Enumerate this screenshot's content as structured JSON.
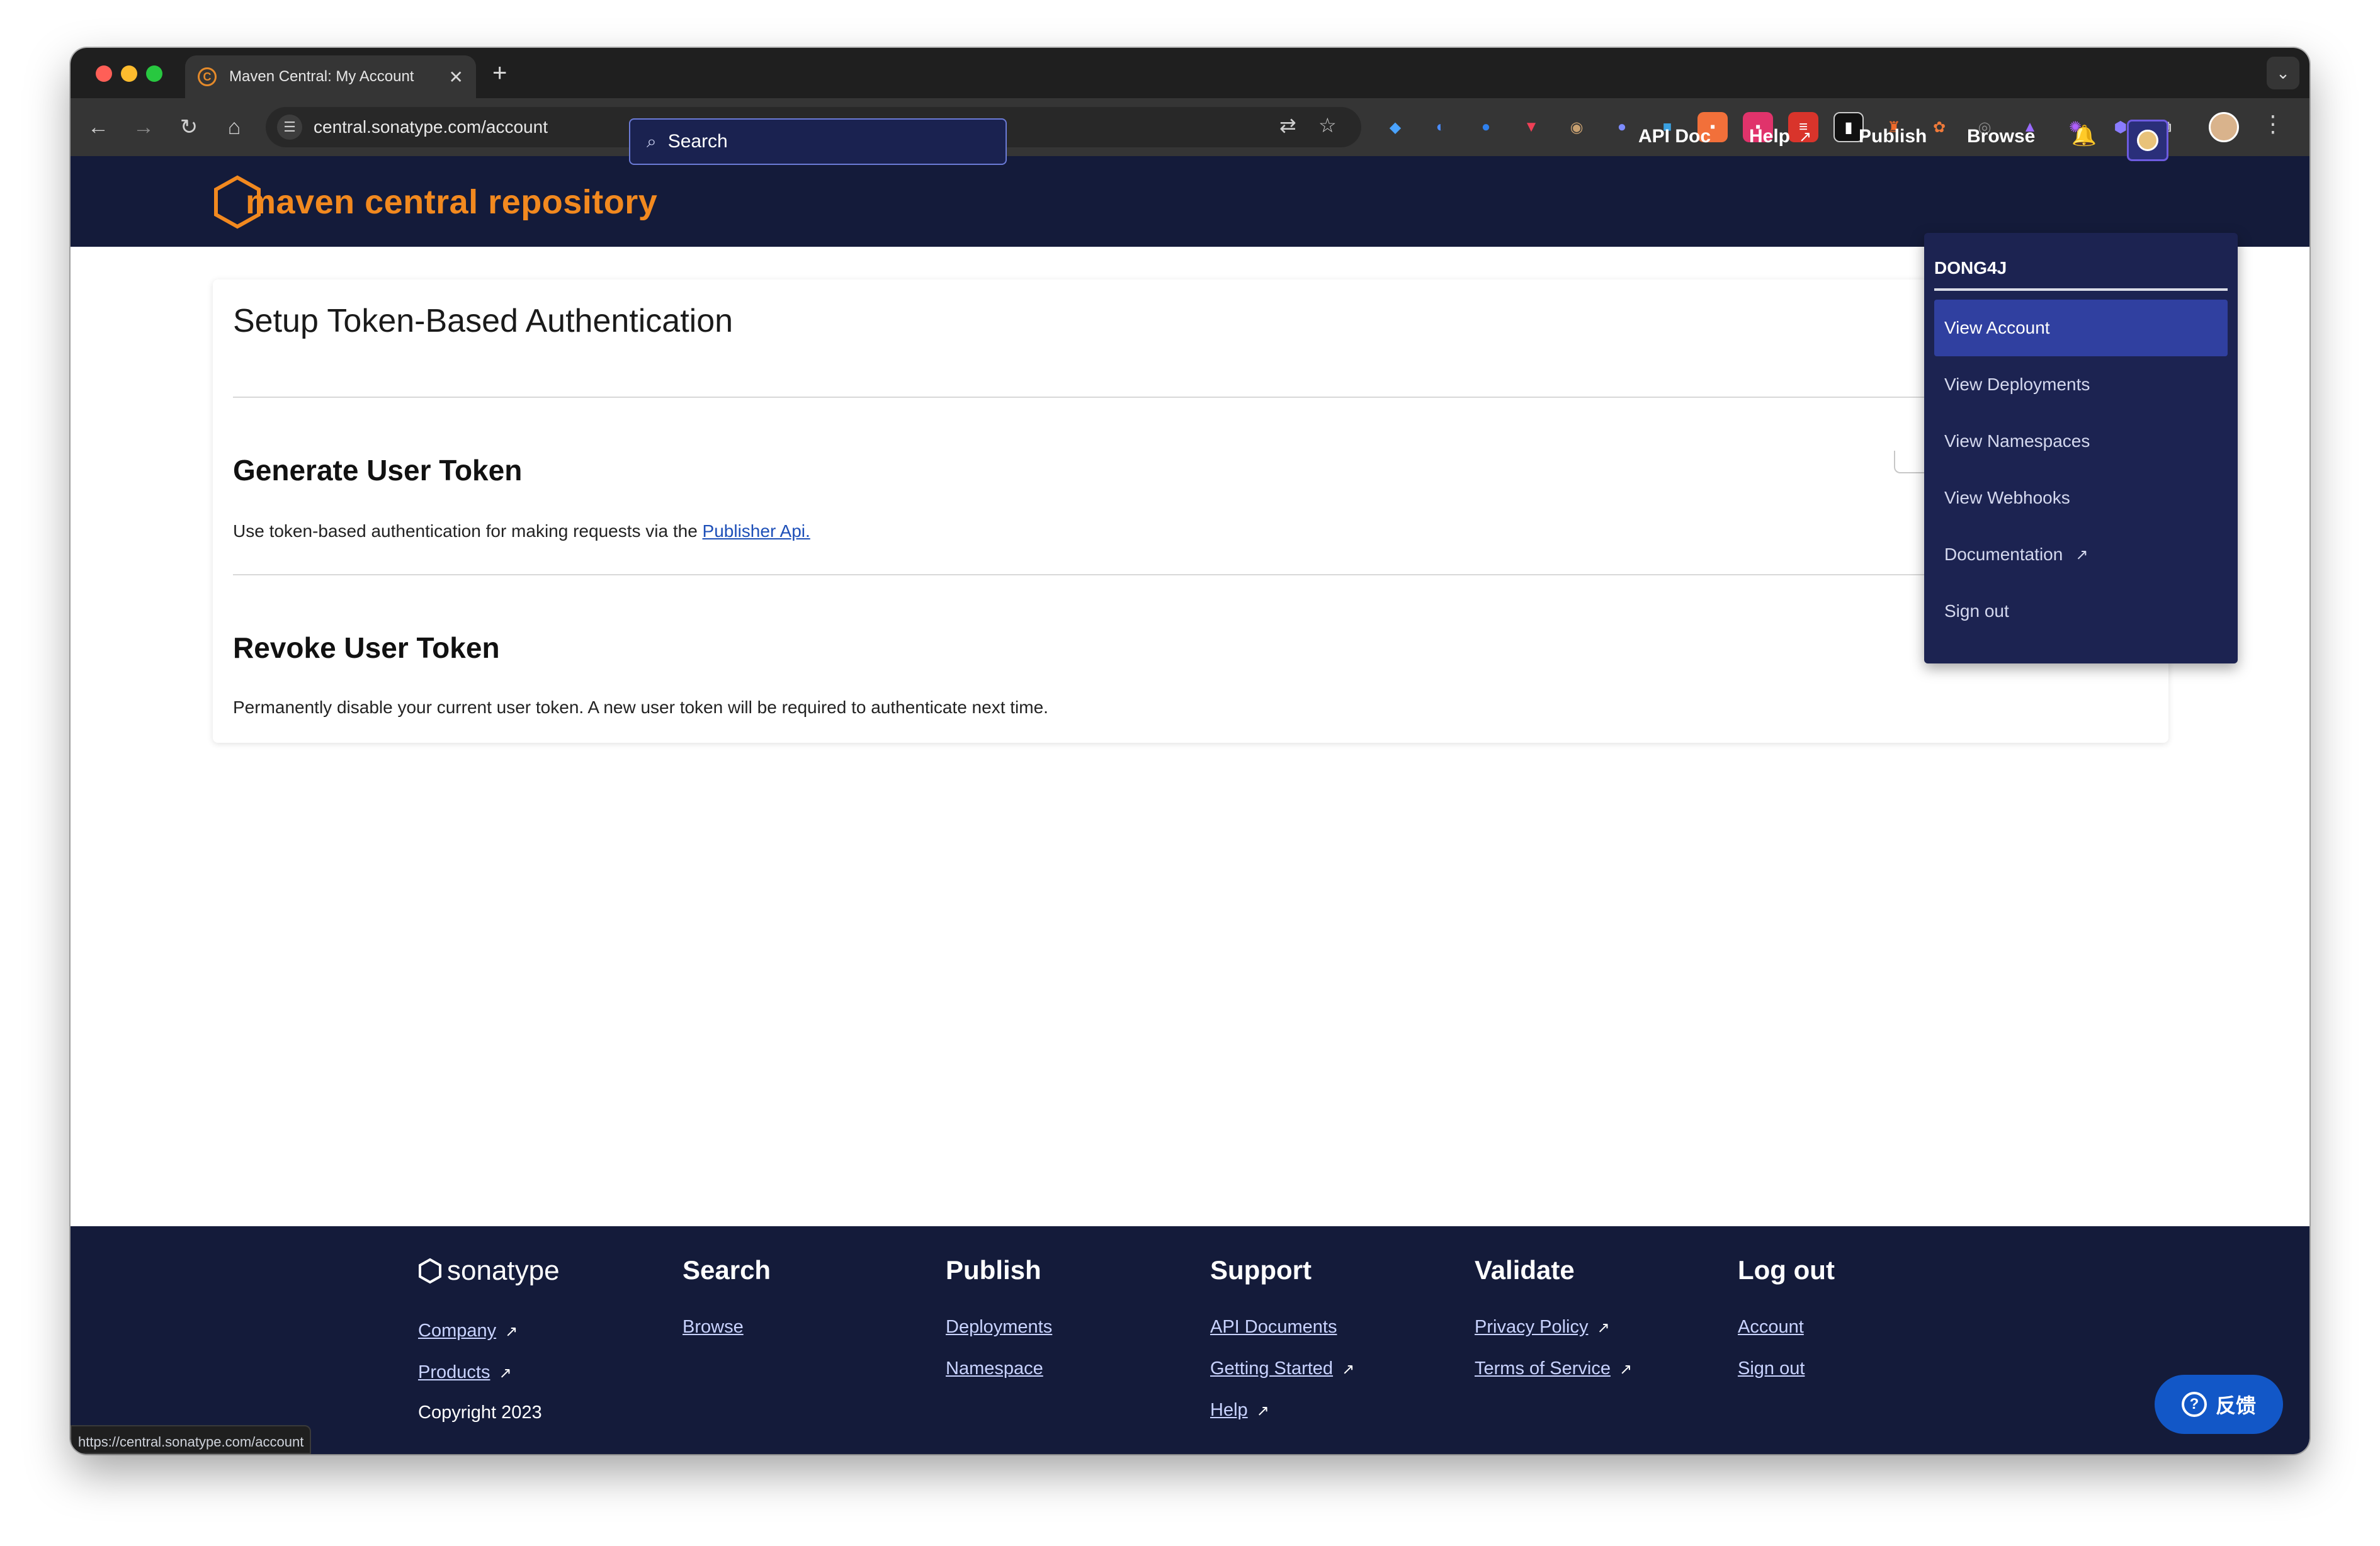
{
  "browser": {
    "tab_title": "Maven Central: My Account",
    "url": "central.sonatype.com/account",
    "status_url": "https://central.sonatype.com/account"
  },
  "header": {
    "logo_text": "maven central repository",
    "search_placeholder": "Search",
    "nav": {
      "api_doc": "API Doc",
      "help": "Help",
      "publish": "Publish",
      "browse": "Browse"
    }
  },
  "account_menu": {
    "username": "DONG4J",
    "items": [
      {
        "label": "View Account"
      },
      {
        "label": "View Deployments"
      },
      {
        "label": "View Namespaces"
      },
      {
        "label": "View Webhooks"
      },
      {
        "label": "Documentation"
      },
      {
        "label": "Sign out"
      }
    ]
  },
  "main": {
    "title": "Setup Token-Based Authentication",
    "generate": {
      "heading": "Generate User Token",
      "text": "Use token-based authentication for making requests via the ",
      "link": "Publisher Api."
    },
    "revoke": {
      "heading": "Revoke User Token",
      "text": "Permanently disable your current user token. A new user token will be required to authenticate next time."
    }
  },
  "footer": {
    "brand": "sonatype",
    "company": "Company",
    "products": "Products",
    "copyright": "Copyright 2023",
    "columns": {
      "search": {
        "title": "Search",
        "links": [
          "Browse"
        ]
      },
      "publish": {
        "title": "Publish",
        "links": [
          "Deployments",
          "Namespace"
        ]
      },
      "support": {
        "title": "Support",
        "links": [
          "API Documents",
          "Getting Started",
          "Help"
        ]
      },
      "validate": {
        "title": "Validate",
        "links": [
          "Privacy Policy",
          "Terms of Service"
        ]
      },
      "logout": {
        "title": "Log out",
        "links": [
          "Account",
          "Sign out"
        ]
      }
    }
  },
  "feedback": {
    "label": "反馈"
  },
  "colors": {
    "header_bg": "#141b3a",
    "brand_orange": "#f2891f",
    "menu_bg": "#1c2351",
    "menu_active": "#3040a0",
    "feedback_blue": "#1257c7"
  }
}
